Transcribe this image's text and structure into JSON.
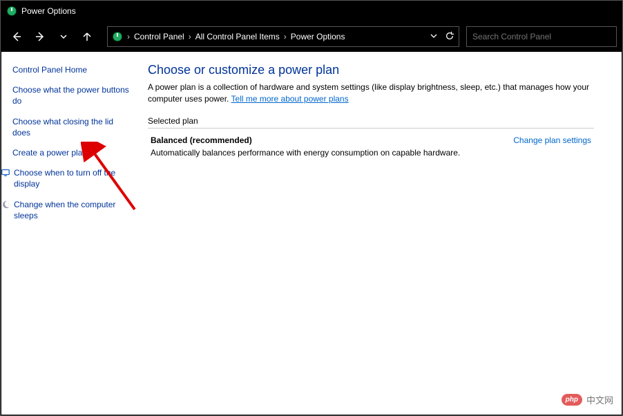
{
  "window": {
    "title": "Power Options"
  },
  "breadcrumb": {
    "item0": "Control Panel",
    "item1": "All Control Panel Items",
    "item2": "Power Options"
  },
  "search": {
    "placeholder": "Search Control Panel"
  },
  "sidebar": {
    "home": "Control Panel Home",
    "links": {
      "0": "Choose what the power buttons do",
      "1": "Choose what closing the lid does",
      "2": "Create a power plan",
      "3": "Choose when to turn off the display",
      "4": "Change when the computer sleeps"
    }
  },
  "main": {
    "heading": "Choose or customize a power plan",
    "description": "A power plan is a collection of hardware and system settings (like display brightness, sleep, etc.) that manages how your computer uses power. ",
    "help_link": "Tell me more about power plans",
    "section_label": "Selected plan",
    "plan": {
      "name": "Balanced (recommended)",
      "desc": "Automatically balances performance with energy consumption on capable hardware.",
      "change": "Change plan settings"
    }
  },
  "watermark": {
    "badge": "php",
    "text": "中文网"
  }
}
